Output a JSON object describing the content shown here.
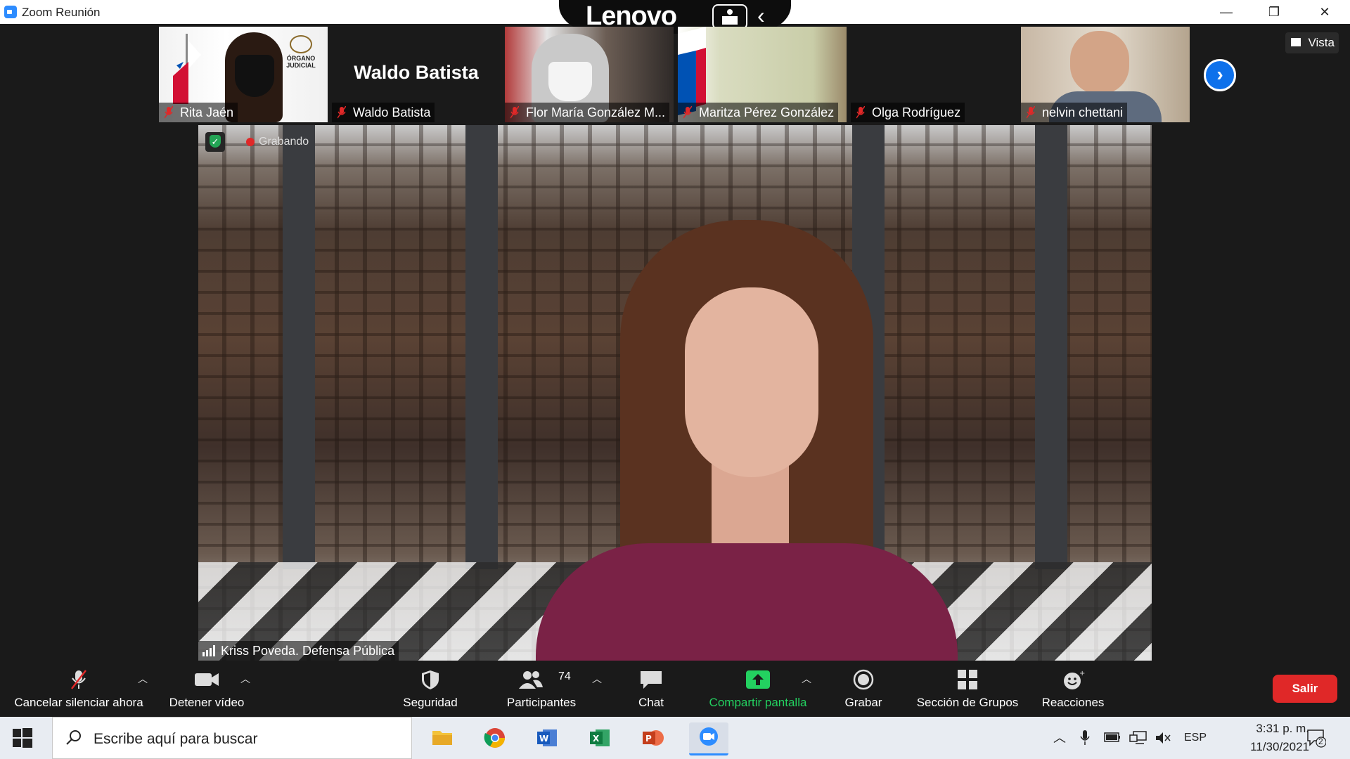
{
  "window": {
    "title": "Zoom Reunión",
    "minimize": "—",
    "restore": "❐",
    "close": "✕"
  },
  "overlay": {
    "brand": "Lenovo"
  },
  "participants": [
    {
      "name": "Rita Jaén",
      "muted": true,
      "video": true
    },
    {
      "name": "Waldo Batista",
      "display_name": "Waldo Batista",
      "muted": true,
      "video": false
    },
    {
      "name": "Flor María González M...",
      "muted": true,
      "video": true
    },
    {
      "name": "Maritza Pérez  González",
      "muted": true,
      "video": true
    },
    {
      "name": "Olga Rodríguez",
      "muted": true,
      "video": false
    },
    {
      "name": "nelvin chettani",
      "muted": true,
      "video": true
    }
  ],
  "tile_badge": {
    "line1": "ÓRGANO",
    "line2": "JUDICIAL"
  },
  "view_button": "Vista",
  "recording": {
    "label": "Grabando"
  },
  "active_speaker": {
    "name": "Kriss Poveda. Defensa Pública"
  },
  "toolbar": {
    "unmute": "Cancelar silenciar ahora",
    "stop_video": "Detener vídeo",
    "security": "Seguridad",
    "participants": "Participantes",
    "participants_count": "74",
    "chat": "Chat",
    "share": "Compartir pantalla",
    "record": "Grabar",
    "breakout": "Sección de Grupos",
    "reactions": "Reacciones",
    "leave": "Salir"
  },
  "taskbar": {
    "search_placeholder": "Escribe aquí para buscar",
    "language": "ESP",
    "time": "3:31 p. m.",
    "date": "11/30/2021",
    "notifications": "2"
  },
  "colors": {
    "accent": "#2d8cff",
    "share_green": "#23d160",
    "leave_red": "#e02828",
    "muted_red": "#e02828"
  }
}
